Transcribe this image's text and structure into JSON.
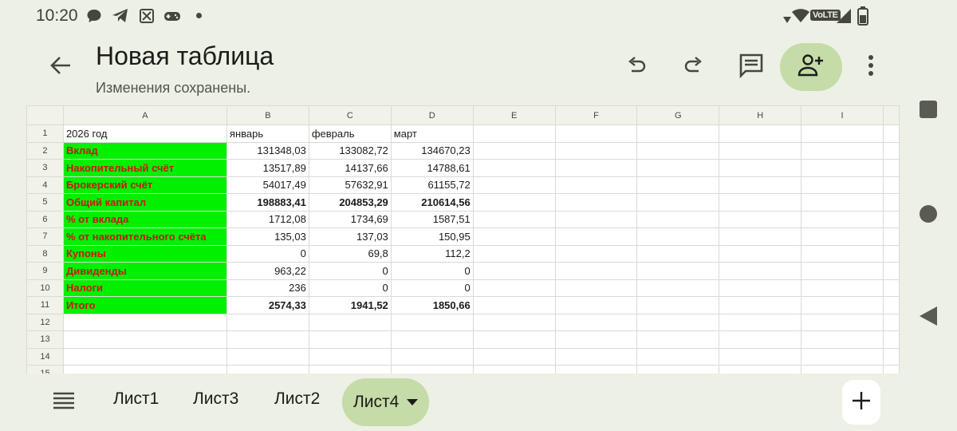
{
  "status_bar": {
    "time": "10:20",
    "network_badge": "VoLTE",
    "icons": [
      "chat-bubble-icon",
      "telegram-icon",
      "sheets-app-icon",
      "gamepad-icon",
      "dot-icon",
      "wifi-icon",
      "signal-icon",
      "battery-icon"
    ]
  },
  "app_bar": {
    "title": "Новая таблица",
    "subtitle": "Изменения сохранены.",
    "icons": [
      "back-arrow-icon",
      "undo-icon",
      "redo-icon",
      "comment-icon",
      "add-person-icon",
      "more-vert-icon"
    ]
  },
  "sheet": {
    "columns": [
      "A",
      "B",
      "C",
      "D",
      "E",
      "F",
      "G",
      "H",
      "I"
    ],
    "rows": [
      {
        "n": "1",
        "a": "2026 год",
        "b": "январь",
        "c": "февраль",
        "d": "март",
        "style": "header"
      },
      {
        "n": "2",
        "a": "Вклад",
        "b": "131348,03",
        "c": "133082,72",
        "d": "134670,23",
        "style": "normal"
      },
      {
        "n": "3",
        "a": "Накопительный счёт",
        "b": "13517,89",
        "c": "14137,66",
        "d": "14788,61",
        "style": "normal"
      },
      {
        "n": "4",
        "a": "Брокерский счёт",
        "b": "54017,49",
        "c": "57632,91",
        "d": "61155,72",
        "style": "normal"
      },
      {
        "n": "5",
        "a": "Общий капитал",
        "b": "198883,41",
        "c": "204853,29",
        "d": "210614,56",
        "style": "bold"
      },
      {
        "n": "6",
        "a": "% от вклада",
        "b": "1712,08",
        "c": "1734,69",
        "d": "1587,51",
        "style": "normal"
      },
      {
        "n": "7",
        "a": "% от накопительного счёта",
        "b": "135,03",
        "c": "137,03",
        "d": "150,95",
        "style": "normal"
      },
      {
        "n": "8",
        "a": "Купоны",
        "b": "0",
        "c": "69,8",
        "d": "112,2",
        "style": "normal"
      },
      {
        "n": "9",
        "a": "Дивиденды",
        "b": "963,22",
        "c": "0",
        "d": "0",
        "style": "normal"
      },
      {
        "n": "10",
        "a": "Налоги",
        "b": "236",
        "c": "0",
        "d": "0",
        "style": "normal"
      },
      {
        "n": "11",
        "a": "Итого",
        "b": "2574,33",
        "c": "1941,52",
        "d": "1850,66",
        "style": "bold"
      },
      {
        "n": "12",
        "a": "",
        "b": "",
        "c": "",
        "d": "",
        "style": "empty"
      },
      {
        "n": "13",
        "a": "",
        "b": "",
        "c": "",
        "d": "",
        "style": "empty"
      },
      {
        "n": "14",
        "a": "",
        "b": "",
        "c": "",
        "d": "",
        "style": "empty"
      },
      {
        "n": "15",
        "a": "",
        "b": "",
        "c": "",
        "d": "",
        "style": "empty"
      }
    ],
    "label_fill_color": "#00f000",
    "label_text_color": "#d01414"
  },
  "bottom_bar": {
    "tabs": [
      {
        "label": "Лист1",
        "active": false
      },
      {
        "label": "Лист3",
        "active": false
      },
      {
        "label": "Лист2",
        "active": false
      },
      {
        "label": "Лист4",
        "active": true
      }
    ],
    "icons": [
      "sheets-list-icon",
      "add-sheet-icon"
    ]
  },
  "nav_bar": {
    "icons": [
      "recents-square-icon",
      "home-circle-icon",
      "back-triangle-icon"
    ]
  },
  "colors": {
    "background": "#edf0e4",
    "accent_container": "#c5dba8"
  }
}
